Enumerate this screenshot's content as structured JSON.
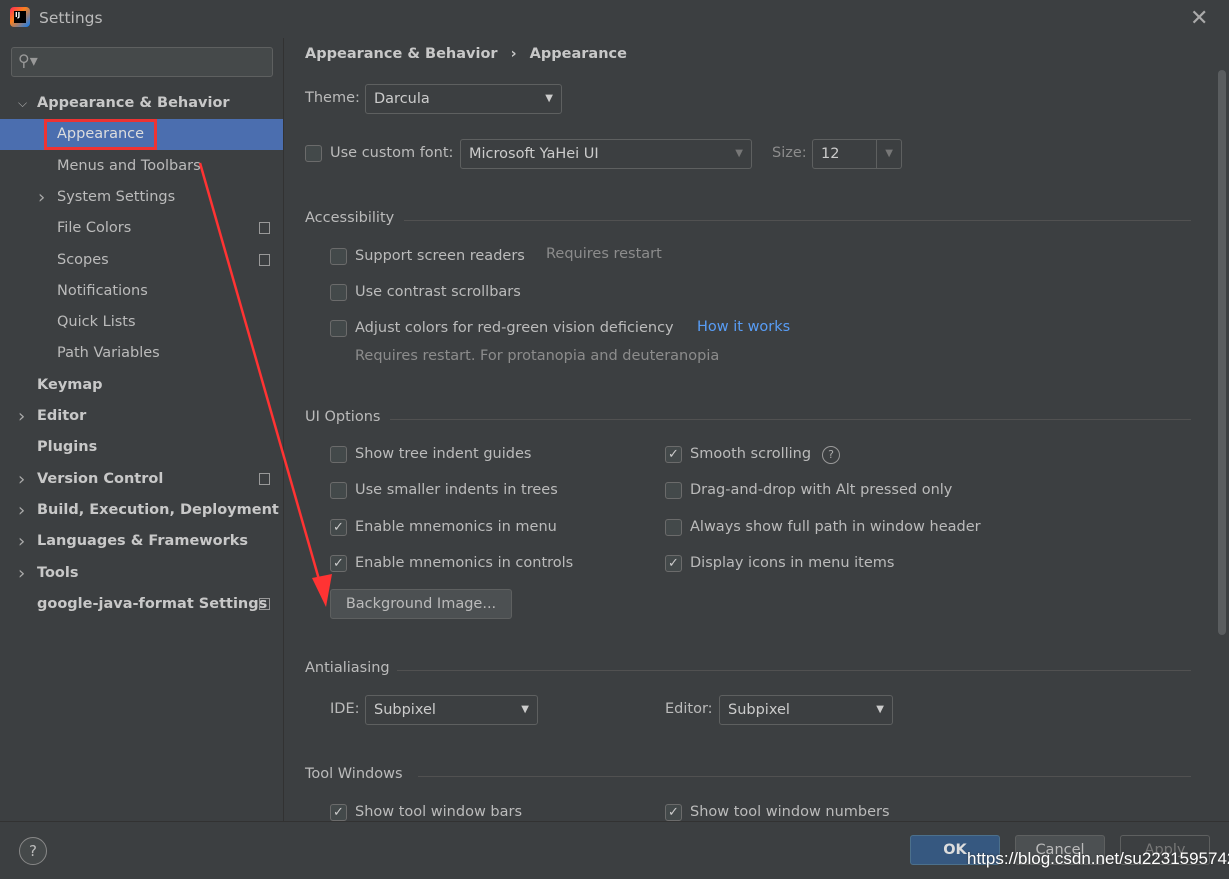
{
  "window": {
    "title": "Settings",
    "close": "✕"
  },
  "sidebar": {
    "search_placeholder": "",
    "items": [
      {
        "label": "Appearance & Behavior",
        "level": 0,
        "bold": true,
        "arrow": "down"
      },
      {
        "label": "Appearance",
        "level": 1,
        "selected": true
      },
      {
        "label": "Menus and Toolbars",
        "level": 1
      },
      {
        "label": "System Settings",
        "level": 1,
        "arrow": "right"
      },
      {
        "label": "File Colors",
        "level": 1,
        "project_icon": true
      },
      {
        "label": "Scopes",
        "level": 1,
        "project_icon": true
      },
      {
        "label": "Notifications",
        "level": 1
      },
      {
        "label": "Quick Lists",
        "level": 1
      },
      {
        "label": "Path Variables",
        "level": 1
      },
      {
        "label": "Keymap",
        "level": 0,
        "bold": true
      },
      {
        "label": "Editor",
        "level": 0,
        "bold": true,
        "arrow": "right"
      },
      {
        "label": "Plugins",
        "level": 0,
        "bold": true
      },
      {
        "label": "Version Control",
        "level": 0,
        "bold": true,
        "arrow": "right",
        "project_icon": true
      },
      {
        "label": "Build, Execution, Deployment",
        "level": 0,
        "bold": true,
        "arrow": "right"
      },
      {
        "label": "Languages & Frameworks",
        "level": 0,
        "bold": true,
        "arrow": "right"
      },
      {
        "label": "Tools",
        "level": 0,
        "bold": true,
        "arrow": "right"
      },
      {
        "label": "google-java-format Settings",
        "level": 0,
        "bold": true,
        "project_icon": true
      }
    ]
  },
  "breadcrumb": {
    "parent": "Appearance & Behavior",
    "sep": "›",
    "current": "Appearance"
  },
  "theme": {
    "label": "Theme:",
    "value": "Darcula"
  },
  "font": {
    "label": "Use custom font:",
    "checked": false,
    "value": "Microsoft YaHei UI",
    "size_label": "Size:",
    "size": "12"
  },
  "accessibility": {
    "title": "Accessibility",
    "screen_readers": "Support screen readers",
    "requires_restart": "Requires restart",
    "contrast": "Use contrast scrollbars",
    "adjust": "Adjust colors for red-green vision deficiency",
    "how": "How it works",
    "adjust_note": "Requires restart. For protanopia and deuteranopia"
  },
  "ui_options": {
    "title": "UI Options",
    "left": [
      {
        "label": "Show tree indent guides",
        "checked": false
      },
      {
        "label": "Use smaller indents in trees",
        "checked": false
      },
      {
        "label": "Enable mnemonics in menu",
        "checked": true
      },
      {
        "label": "Enable mnemonics in controls",
        "checked": true
      }
    ],
    "right": [
      {
        "label": "Smooth scrolling",
        "checked": true
      },
      {
        "label": "Drag-and-drop with Alt pressed only",
        "checked": false
      },
      {
        "label": "Always show full path in window header",
        "checked": false
      },
      {
        "label": "Display icons in menu items",
        "checked": true
      }
    ],
    "bg_button": "Background Image..."
  },
  "antialiasing": {
    "title": "Antialiasing",
    "ide_label": "IDE:",
    "ide": "Subpixel",
    "editor_label": "Editor:",
    "editor": "Subpixel"
  },
  "tool_windows": {
    "title": "Tool Windows",
    "bars": "Show tool window bars",
    "numbers": "Show tool window numbers"
  },
  "footer": {
    "help": "?",
    "ok": "OK",
    "cancel": "Cancel",
    "apply": "Apply"
  },
  "watermark": "https://blog.csdn.net/su2231595742",
  "colors": {
    "selection": "#4b6eaf",
    "link": "#589df6",
    "ok": "#365880",
    "annotation": "#ff3333"
  }
}
